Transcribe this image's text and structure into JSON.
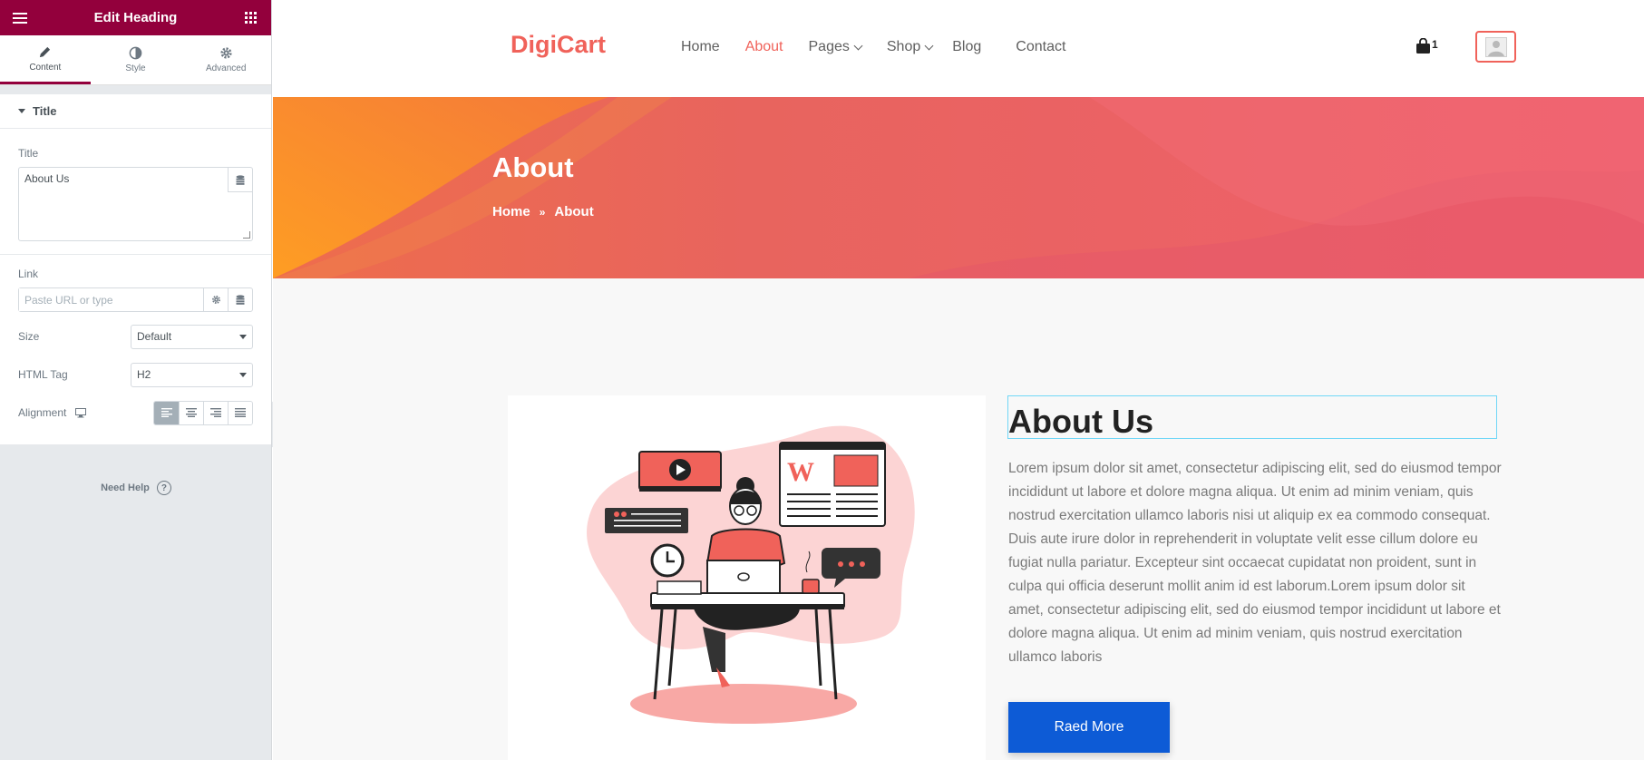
{
  "editor": {
    "header_title": "Edit Heading",
    "tabs": [
      {
        "label": "Content",
        "icon": "pencil-icon"
      },
      {
        "label": "Style",
        "icon": "contrast-icon"
      },
      {
        "label": "Advanced",
        "icon": "gear-icon"
      }
    ],
    "section_title": "Title",
    "title_label": "Title",
    "title_value": "About Us",
    "link_label": "Link",
    "link_placeholder": "Paste URL or type",
    "size_label": "Size",
    "size_value": "Default",
    "html_tag_label": "HTML Tag",
    "html_tag_value": "H2",
    "alignment_label": "Alignment",
    "need_help": "Need Help",
    "accent_color": "#93003c"
  },
  "site": {
    "logo": "DigiCart",
    "nav": [
      {
        "label": "Home"
      },
      {
        "label": "About"
      },
      {
        "label": "Pages"
      },
      {
        "label": "Shop"
      },
      {
        "label": "Blog"
      },
      {
        "label": "Contact"
      }
    ],
    "cart_count": "1",
    "banner_title": "About",
    "breadcrumb": [
      "Home",
      "About"
    ],
    "about_heading": "About Us",
    "about_text": "Lorem ipsum dolor sit amet, consectetur adipiscing elit, sed do eiusmod tempor incididunt ut labore et dolore magna aliqua. Ut enim ad minim veniam, quis nostrud exercitation ullamco laboris nisi ut aliquip ex ea commodo consequat. Duis aute irure dolor in reprehenderit in voluptate velit esse cillum dolore eu fugiat nulla pariatur. Excepteur sint occaecat cupidatat non proident, sunt in culpa qui officia deserunt mollit anim id est laborum.Lorem ipsum dolor sit amet, consectetur adipiscing elit, sed do eiusmod tempor incididunt ut labore et dolore magna aliqua. Ut enim ad minim veniam, quis nostrud exercitation ullamco laboris",
    "read_more": "Raed More",
    "brand_color": "#f0625a",
    "button_color": "#0d5bd6"
  }
}
